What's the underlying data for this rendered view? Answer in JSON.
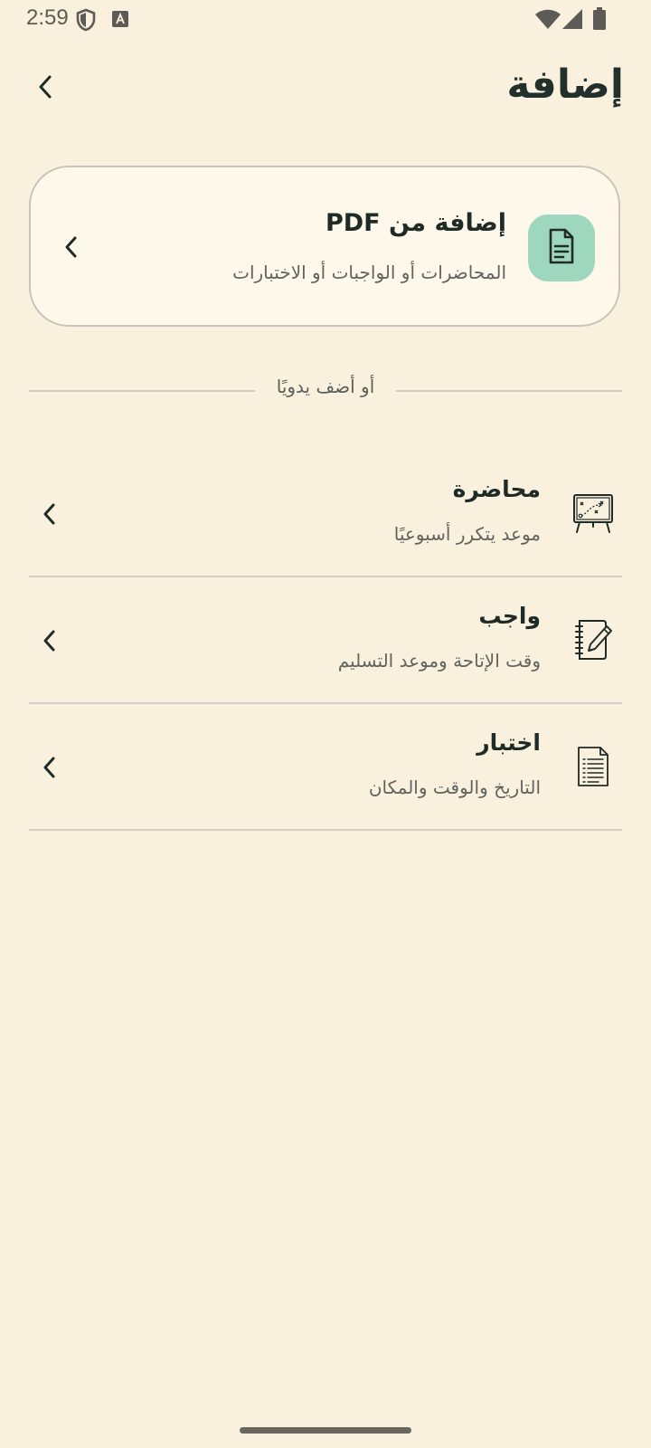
{
  "status_bar": {
    "time": "2:59",
    "left_icons": [
      "shield-icon",
      "keyboard-a-icon"
    ],
    "right_icons": [
      "wifi-icon",
      "signal-icon",
      "battery-icon"
    ]
  },
  "header": {
    "title": "إضافة",
    "back_icon": "chevron-left-icon"
  },
  "pdf_card": {
    "title": "إضافة من PDF",
    "subtitle": "المحاضرات أو الواجبات أو الاختبارات",
    "icon": "document-icon",
    "icon_bg": "#9dd7be",
    "chevron_icon": "chevron-left-icon"
  },
  "divider": {
    "label": "أو أضف يدويًا"
  },
  "items": [
    {
      "title": "محاضرة",
      "subtitle": "موعد يتكرر أسبوعيًا",
      "icon": "whiteboard-icon"
    },
    {
      "title": "واجب",
      "subtitle": "وقت الإتاحة وموعد التسليم",
      "icon": "notebook-pen-icon"
    },
    {
      "title": "اختبار",
      "subtitle": "التاريخ والوقت والمكان",
      "icon": "exam-sheet-icon"
    }
  ],
  "colors": {
    "background": "#f9f1de",
    "card_background": "#fdf8ea",
    "text_primary": "#1f2b27",
    "text_secondary": "#62635e",
    "accent": "#9dd7be"
  }
}
